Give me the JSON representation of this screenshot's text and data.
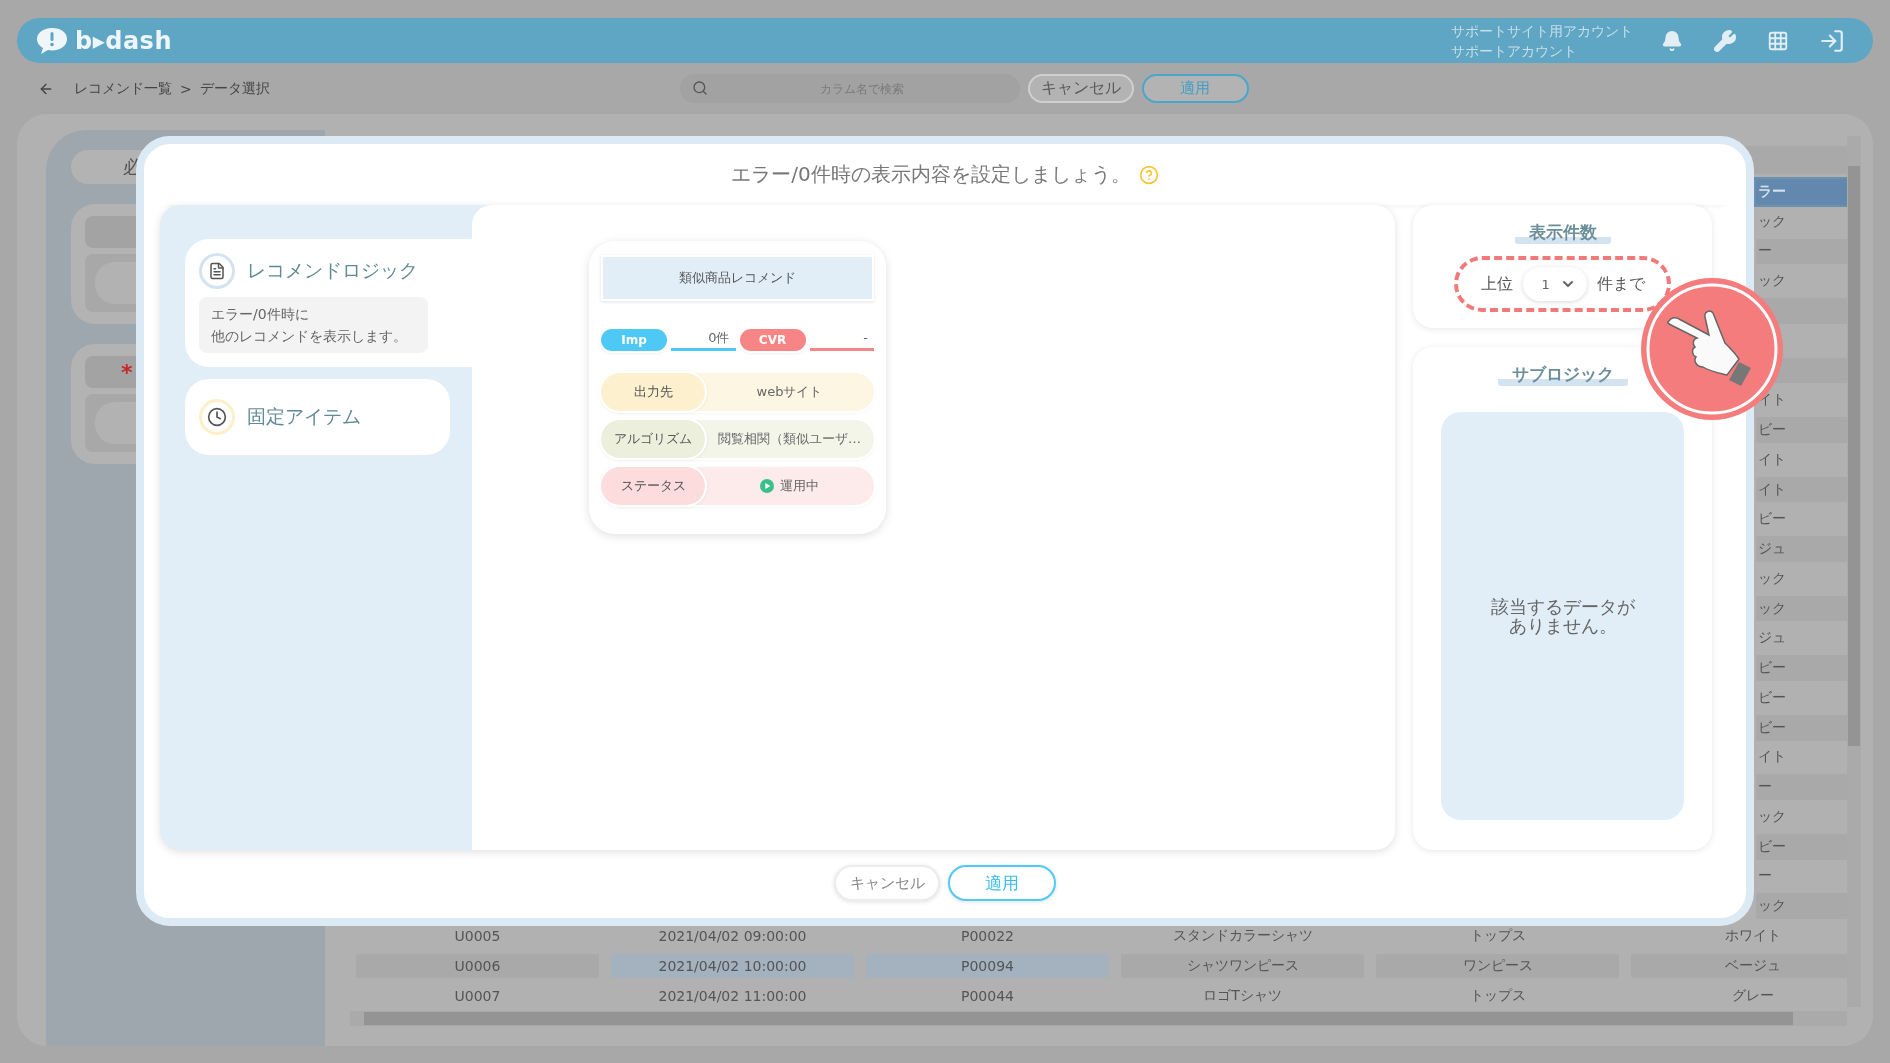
{
  "header": {
    "logo": "b▸dash",
    "account_lines": [
      "サポートサイト用アカウント",
      "サポートアカウント"
    ]
  },
  "toolbar": {
    "breadcrumb": [
      "レコメンド一覧",
      "データ選択"
    ],
    "separator": ">",
    "search": {
      "placeholder": "カラム名で検索"
    },
    "buttons": [
      {
        "label": "キャンセル",
        "kind": "secondary"
      },
      {
        "label": "適用",
        "kind": "primary"
      }
    ]
  },
  "side_panel": {
    "pill_text": "必",
    "required_mark": "*"
  },
  "table": {
    "rows": [
      {
        "selected": true,
        "tail": "ラー"
      },
      {
        "selected": false,
        "tail": "ック"
      },
      {
        "selected": false,
        "tail": "ー"
      },
      {
        "selected": false,
        "tail": "ック"
      },
      {
        "selected": false
      },
      {
        "selected": false
      },
      {
        "selected": false
      },
      {
        "selected": false,
        "tail": "イト"
      },
      {
        "selected": false,
        "tail": "ビー"
      },
      {
        "selected": false,
        "tail": "イト"
      },
      {
        "selected": false,
        "tail": "イト"
      },
      {
        "selected": false,
        "tail": "ビー"
      },
      {
        "selected": false,
        "tail": "ジュ"
      },
      {
        "selected": false,
        "tail": "ック"
      },
      {
        "selected": false,
        "tail": "ック"
      },
      {
        "selected": false,
        "tail": "ジュ"
      },
      {
        "selected": false,
        "tail": "ビー"
      },
      {
        "selected": false,
        "tail": "ビー"
      },
      {
        "selected": false,
        "tail": "ビー"
      },
      {
        "selected": false,
        "tail": "イト"
      },
      {
        "selected": false,
        "tail": "ー"
      },
      {
        "selected": false,
        "tail": "ック"
      },
      {
        "selected": false,
        "tail": "ビー"
      },
      {
        "selected": false,
        "tail": "ー"
      },
      {
        "selected": false,
        "tail": "ック"
      },
      {
        "selected": false,
        "cells": [
          {
            "text": "U0005",
            "highlighted": false
          },
          {
            "text": "2021/04/02 09:00:00",
            "highlighted": false
          },
          {
            "text": "P00022",
            "highlighted": false
          },
          {
            "text": "スタンドカラーシャツ",
            "highlighted": false
          },
          {
            "text": "トップス",
            "highlighted": false
          },
          {
            "text": "ホワイト",
            "highlighted": false
          }
        ]
      },
      {
        "selected": false,
        "cells": [
          {
            "text": "U0006",
            "highlighted": false
          },
          {
            "text": "2021/04/02 10:00:00",
            "highlighted": true
          },
          {
            "text": "P00094",
            "highlighted": true
          },
          {
            "text": "シャツワンピース",
            "highlighted": false
          },
          {
            "text": "ワンピース",
            "highlighted": false
          },
          {
            "text": "ベージュ",
            "highlighted": false
          }
        ]
      },
      {
        "selected": false,
        "cells": [
          {
            "text": "U0007",
            "highlighted": false
          },
          {
            "text": "2021/04/02 11:00:00",
            "highlighted": false
          },
          {
            "text": "P00044",
            "highlighted": false
          },
          {
            "text": "ロゴTシャツ",
            "highlighted": false
          },
          {
            "text": "トップス",
            "highlighted": false
          },
          {
            "text": "グレー",
            "highlighted": false
          }
        ]
      }
    ]
  },
  "modal": {
    "title": "エラー/0件時の表示内容を設定しましょう。",
    "tabs": [
      {
        "label": "レコメンドロジック",
        "selected": true,
        "description_lines": [
          "エラー/0件時に",
          "他のレコメンドを表示します。"
        ]
      },
      {
        "label": "固定アイテム",
        "selected": false
      }
    ],
    "card": {
      "title": "類似商品レコメンド",
      "metrics": [
        {
          "label": "Imp",
          "value": "0件",
          "color": "#4ec8f4"
        },
        {
          "label": "CVR",
          "value": "-",
          "color": "#f78585"
        }
      ],
      "rows": [
        {
          "label": "出力先",
          "value": "webサイト",
          "color": "#fcf0cf",
          "kind": "plain"
        },
        {
          "label": "アルゴリズム",
          "value": "閲覧相関（類似ユーザ…",
          "color": "#ebefdb",
          "kind": "plain"
        },
        {
          "label": "ステータス",
          "value": "運用中",
          "color": "#fcdcdc",
          "kind": "status"
        }
      ]
    },
    "display_count": {
      "title": "表示件数",
      "prefix": "上位",
      "value": "1",
      "suffix": "件まで",
      "highlighted": true
    },
    "sublogic": {
      "title": "サブロジック",
      "empty_message_lines": [
        "該当するデータが",
        "ありません。"
      ]
    },
    "buttons": [
      {
        "label": "キャンセル",
        "kind": "secondary"
      },
      {
        "label": "適用",
        "kind": "primary"
      }
    ]
  }
}
